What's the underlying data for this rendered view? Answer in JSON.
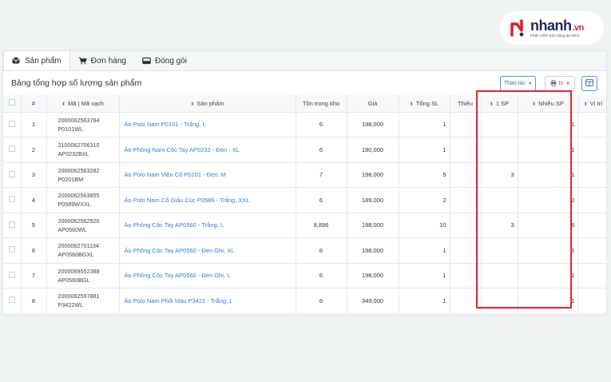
{
  "brand": {
    "name_main": "nhanh",
    "name_suffix": ".vn",
    "tagline": "Phần mềm bán hàng đa kênh"
  },
  "tabs": [
    {
      "label": "Sản phẩm",
      "icon": "box-icon",
      "active": true
    },
    {
      "label": "Đơn hàng",
      "icon": "cart-icon",
      "active": false
    },
    {
      "label": "Đóng gói",
      "icon": "package-icon",
      "active": false
    }
  ],
  "toolbar": {
    "title": "Bảng tổng hợp số lượng sản phẩm",
    "action_label": "Thao tác",
    "print_label": "In"
  },
  "table": {
    "headers": {
      "num": "#",
      "code": "Mã | Mã vạch",
      "product": "Sản phẩm",
      "stock": "Tồn trong kho",
      "price": "Giá",
      "total": "Tổng SL",
      "missing": "Thiếu",
      "one_sp": "1 SP",
      "multi_sp": "Nhiều SP",
      "location": "Vị trí"
    },
    "rows": [
      {
        "num": "1",
        "barcode": "2000062563794",
        "sku": "P0101WL",
        "product": "Áo Polo Nam P0101 - Trắng, L",
        "stock": "6",
        "price": "198,000",
        "total": "1",
        "missing": "",
        "one_sp": "",
        "multi_sp": "1",
        "location": ""
      },
      {
        "num": "2",
        "barcode": "2100062706310",
        "sku": "AP0232BXL",
        "product": "Áo Phông Nam Cộc Tay AP0232 - Đen - XL",
        "stock": "6",
        "price": "180,000",
        "total": "1",
        "missing": "",
        "one_sp": "",
        "multi_sp": "1",
        "location": ""
      },
      {
        "num": "3",
        "barcode": "2000062563282",
        "sku": "P0201BM",
        "product": "Áo Polo Nam Viền Cổ P0201 - Đen, M",
        "stock": "7",
        "price": "198,000",
        "total": "5",
        "missing": "",
        "one_sp": "3",
        "multi_sp": "1",
        "location": ""
      },
      {
        "num": "4",
        "barcode": "2000062563855",
        "sku": "P0589WXXL",
        "product": "Áo Polo Nam Cổ Giấu Cúc P0589 - Trắng, XXL",
        "stock": "6",
        "price": "189,000",
        "total": "2",
        "missing": "",
        "one_sp": "",
        "multi_sp": "2",
        "location": ""
      },
      {
        "num": "5",
        "barcode": "2000062562926",
        "sku": "AP0560WL",
        "product": "Áo Phông Cộc Tay AP0560 - Trắng, L",
        "stock": "8,896",
        "price": "198,000",
        "total": "10",
        "missing": "",
        "one_sp": "3",
        "multi_sp": "6",
        "location": ""
      },
      {
        "num": "6",
        "barcode": "2000062701134",
        "sku": "AP0560BGXL",
        "product": "Áo Phông Cộc Tay AP0560 - Đen Ghi, XL",
        "stock": "6",
        "price": "198,000",
        "total": "1",
        "missing": "",
        "one_sp": "",
        "multi_sp": "1",
        "location": ""
      },
      {
        "num": "7",
        "barcode": "2000069552388",
        "sku": "AP0560BGL",
        "product": "Áo Phông Cộc Tay AP0560 - Đen Ghi, L",
        "stock": "6",
        "price": "198,000",
        "total": "1",
        "missing": "",
        "one_sp": "",
        "multi_sp": "1",
        "location": ""
      },
      {
        "num": "8",
        "barcode": "2000062597881",
        "sku": "P3422WL",
        "product": "Áo Polo Nam Phối Màu P3422 - Trắng, L",
        "stock": "6",
        "price": "349,000",
        "total": "1",
        "missing": "",
        "one_sp": "",
        "multi_sp": "1",
        "location": ""
      }
    ]
  },
  "colors": {
    "background": "#eef5f1",
    "link": "#2f7ed8",
    "highlight_box": "#e3242b",
    "brand_red": "#d72126",
    "brand_navy": "#1e2a5a"
  }
}
